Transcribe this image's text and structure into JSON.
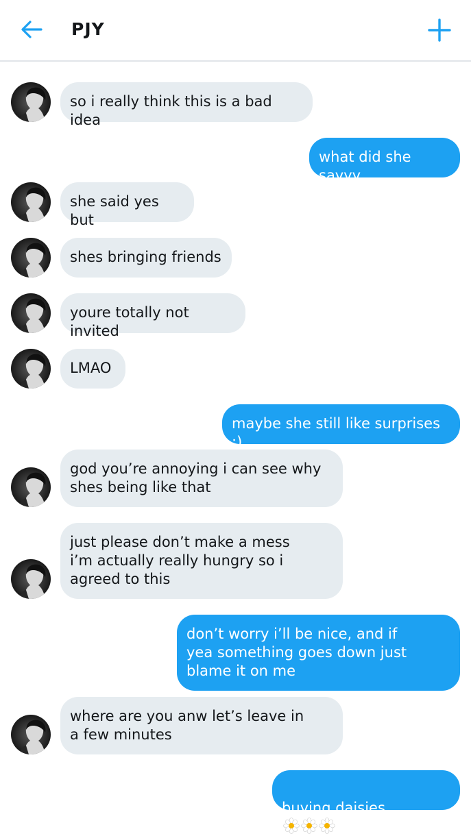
{
  "header": {
    "title": "PJY",
    "back_icon": "arrow-left-icon",
    "new_icon": "plus-icon",
    "accent": "#1da1f2"
  },
  "colors": {
    "incoming_bubble": "#e6ecf0",
    "outgoing_bubble": "#1da1f2"
  },
  "messages": [
    {
      "from": "them",
      "text": "so i really think this is a bad idea"
    },
    {
      "from": "me",
      "text": "what did she sayyy"
    },
    {
      "from": "them",
      "text": "she said yes but"
    },
    {
      "from": "them",
      "text": "shes bringing friends"
    },
    {
      "from": "them",
      "text": "youre totally not invited"
    },
    {
      "from": "them",
      "text": "LMAO"
    },
    {
      "from": "me",
      "text": "maybe she still like surprises :)"
    },
    {
      "from": "them",
      "text": "god you’re annoying i can see why\nshes being like that"
    },
    {
      "from": "them",
      "text": "just please don’t make a mess\ni’m actually really hungry so i\nagreed to this"
    },
    {
      "from": "me",
      "text": "don’t worry i’ll be nice, and if\nyea something goes down just\nblame it on me"
    },
    {
      "from": "them",
      "text": "where are you anw let’s leave in\na few minutes"
    },
    {
      "from": "me",
      "text": "buying daisies",
      "emoji": [
        "daisy-icon",
        "daisy-icon",
        "daisy-icon"
      ]
    }
  ]
}
